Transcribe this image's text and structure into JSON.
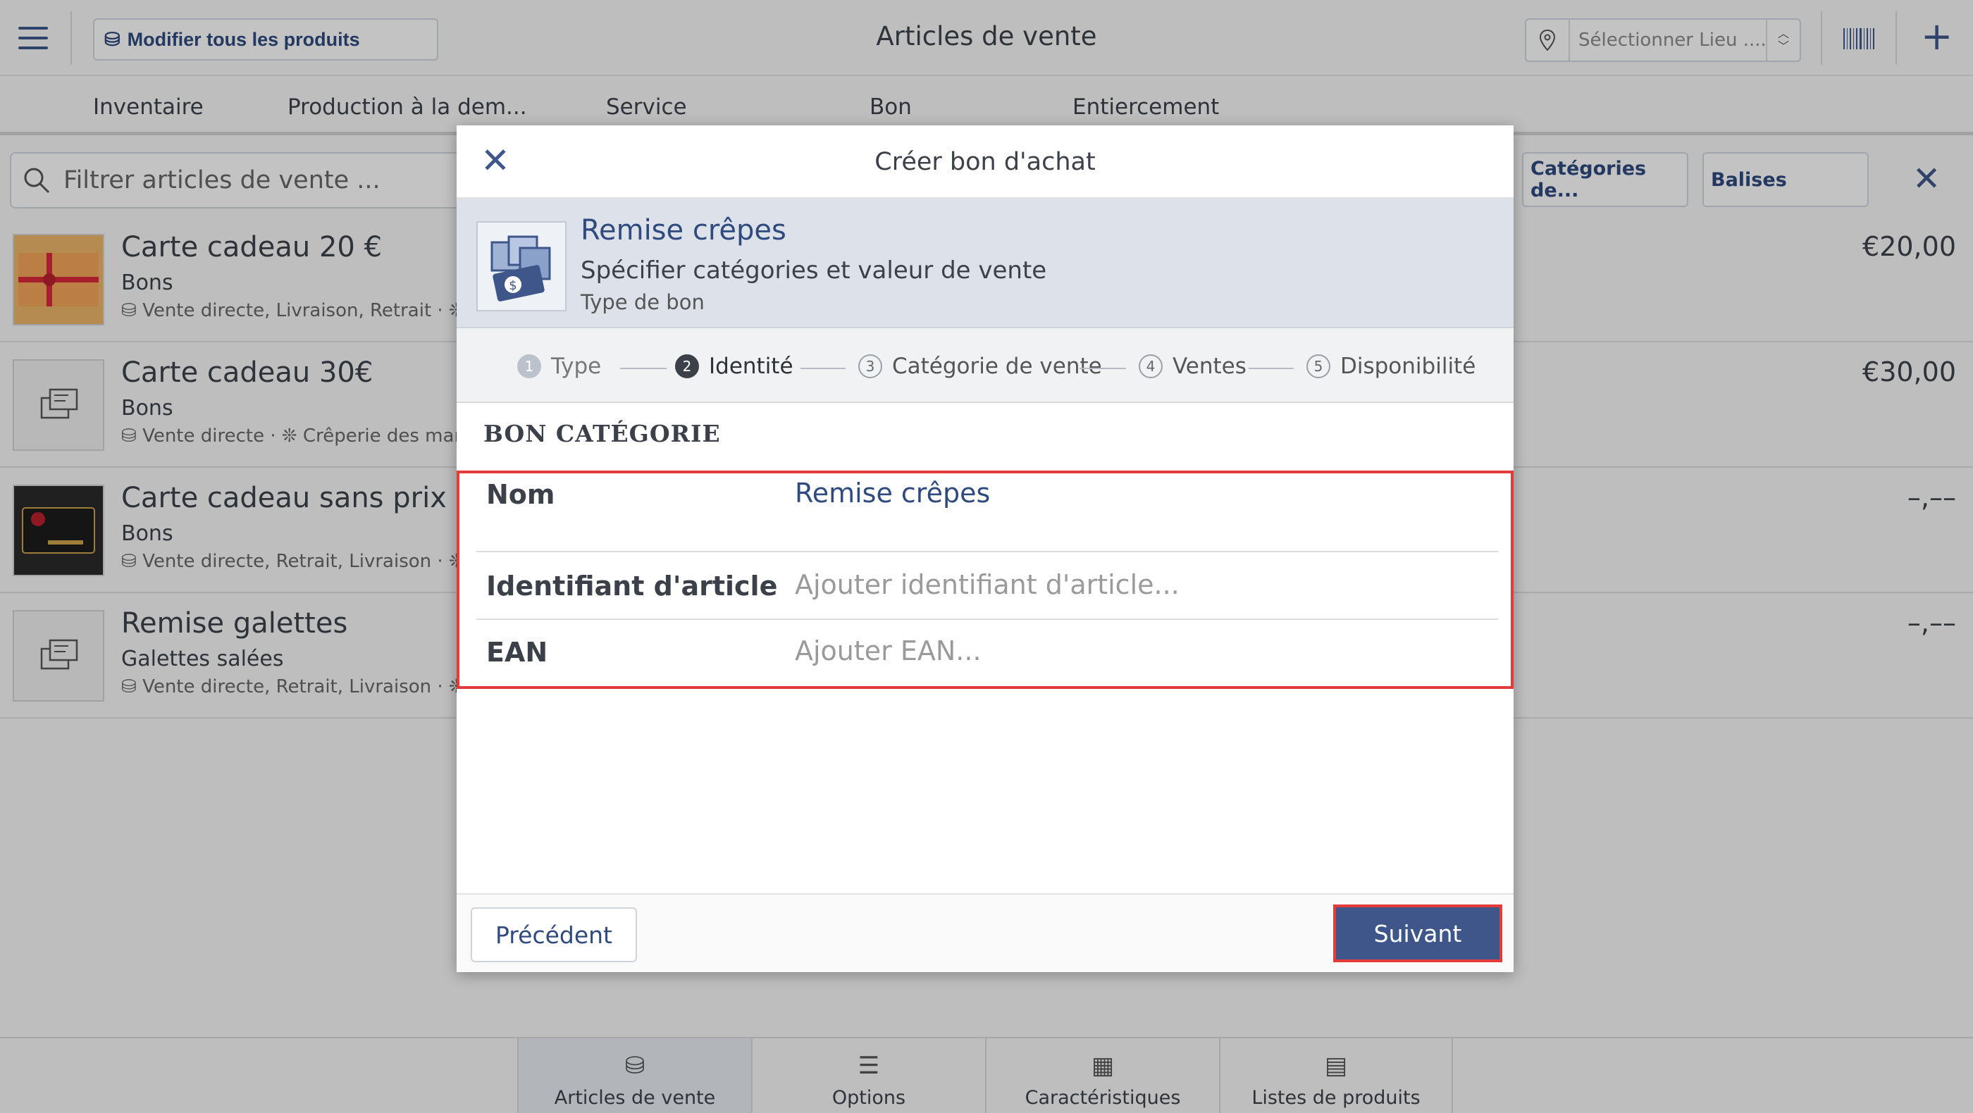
{
  "topbar": {
    "edit_all_label": "Modifier tous les produits",
    "title": "Articles de vente",
    "location_placeholder": "Sélectionner Lieu ......"
  },
  "icons": {
    "menu": "hamburger-menu-icon",
    "location": "location-pin-icon",
    "barcode": "barcode-scanner-icon",
    "add": "plus-icon",
    "search": "search-icon",
    "close": "close-icon"
  },
  "tabs": [
    "Inventaire",
    "Production à la dem...",
    "Service",
    "Bon",
    "Entiercement"
  ],
  "filter": {
    "placeholder": "Filtrer articles de vente ...",
    "chips": [
      "Catégories de...",
      "Balises"
    ]
  },
  "items": [
    {
      "name": "Carte cadeau 20 €",
      "category": "Bons",
      "meta": "Vente directe, Livraison, Retrait · ❊ Cr",
      "price": "€20,00"
    },
    {
      "name": "Carte cadeau 30€",
      "category": "Bons",
      "meta": "Vente directe · ❊ Crêperie des marins",
      "price": "€30,00"
    },
    {
      "name": "Carte cadeau sans prix",
      "category": "Bons",
      "meta": "Vente directe, Retrait, Livraison · ❊ Cr",
      "price": "–,––"
    },
    {
      "name": "Remise galettes",
      "category": "Galettes salées",
      "meta": "Vente directe, Retrait, Livraison · ❊ Cr",
      "price": "–,––"
    }
  ],
  "bottom_tabs": [
    "Articles de vente",
    "Options",
    "Caractéristiques",
    "Listes de produits"
  ],
  "modal": {
    "title": "Créer bon d'achat",
    "summary": {
      "name": "Remise crêpes",
      "subtitle": "Spécifier catégories et valeur de vente",
      "type": "Type de bon"
    },
    "steps": [
      {
        "num": "1",
        "label": "Type"
      },
      {
        "num": "2",
        "label": "Identité"
      },
      {
        "num": "3",
        "label": "Catégorie de vente"
      },
      {
        "num": "4",
        "label": "Ventes"
      },
      {
        "num": "5",
        "label": "Disponibilité"
      }
    ],
    "section_title": "BON CATÉGORIE",
    "fields": {
      "name_label": "Nom",
      "name_value": "Remise crêpes",
      "id_label": "Identifiant d'article",
      "id_placeholder": "Ajouter identifiant d'article...",
      "ean_label": "EAN",
      "ean_placeholder": "Ajouter EAN..."
    },
    "prev_label": "Précédent",
    "next_label": "Suivant"
  },
  "colors": {
    "accent": "#3e5689",
    "highlight": "#e43a3a"
  }
}
